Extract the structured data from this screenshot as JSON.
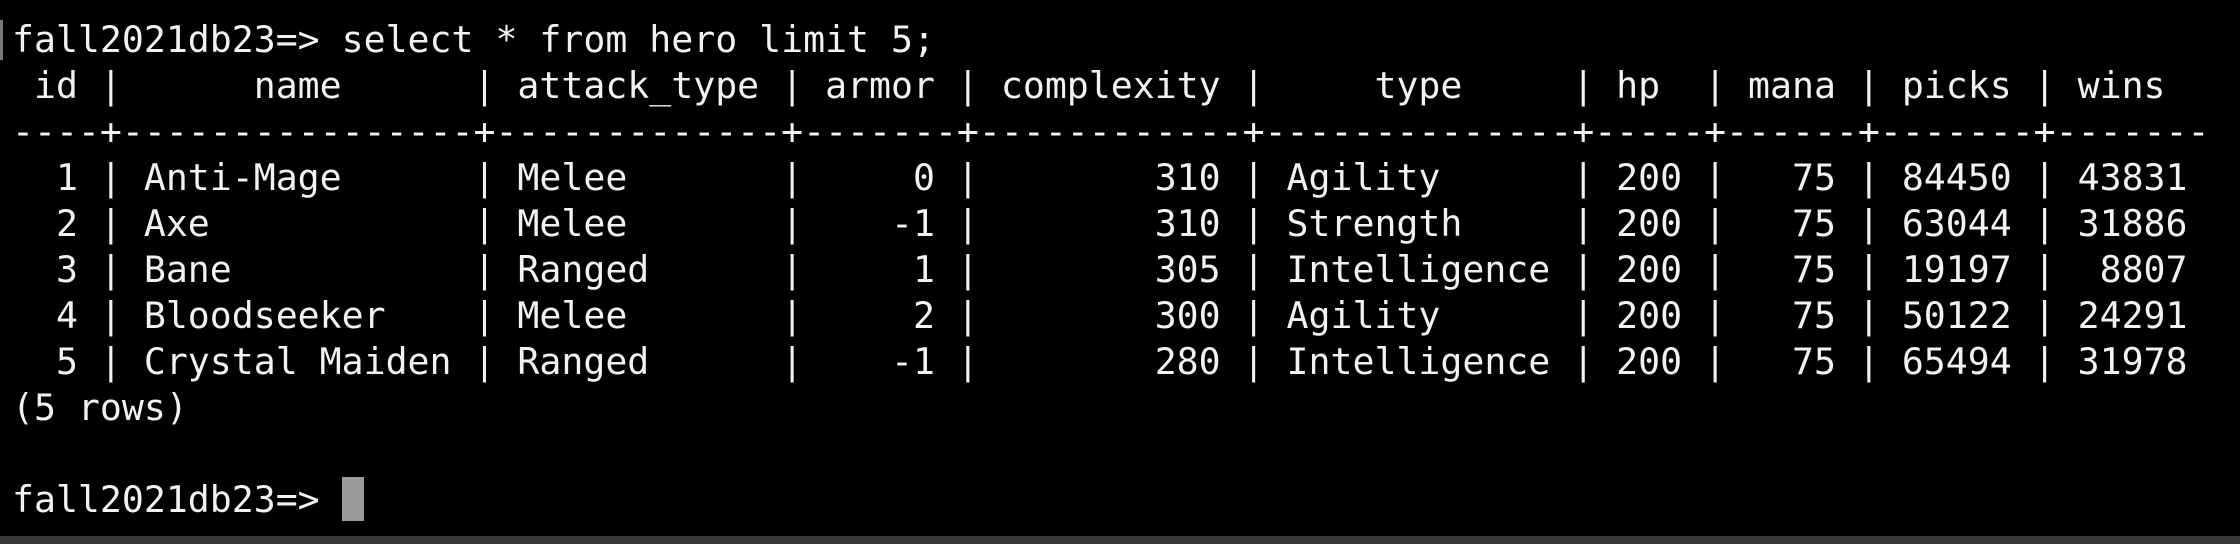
{
  "terminal": {
    "lines": [
      "fall2021db23=> select * from hero limit 5;",
      " id |      name      | attack_type | armor | complexity |     type     | hp  | mana | picks | wins",
      "----+----------------+-------------+-------+------------+--------------+-----+------+-------+-------",
      "  1 | Anti-Mage      | Melee       |     0 |        310 | Agility      | 200 |   75 | 84450 | 43831",
      "  2 | Axe            | Melee       |    -1 |        310 | Strength     | 200 |   75 | 63044 | 31886",
      "  3 | Bane           | Ranged      |     1 |        305 | Intelligence | 200 |   75 | 19197 |  8807",
      "  4 | Bloodseeker    | Melee       |     2 |        300 | Agility      | 200 |   75 | 50122 | 24291",
      "  5 | Crystal Maiden | Ranged      |    -1 |        280 | Intelligence | 200 |   75 | 65494 | 31978",
      "(5 rows)",
      "",
      "fall2021db23=> "
    ],
    "colors": {
      "background": "#000000",
      "text": "#f2f2f2",
      "cursor": "#9b9b9b"
    }
  }
}
